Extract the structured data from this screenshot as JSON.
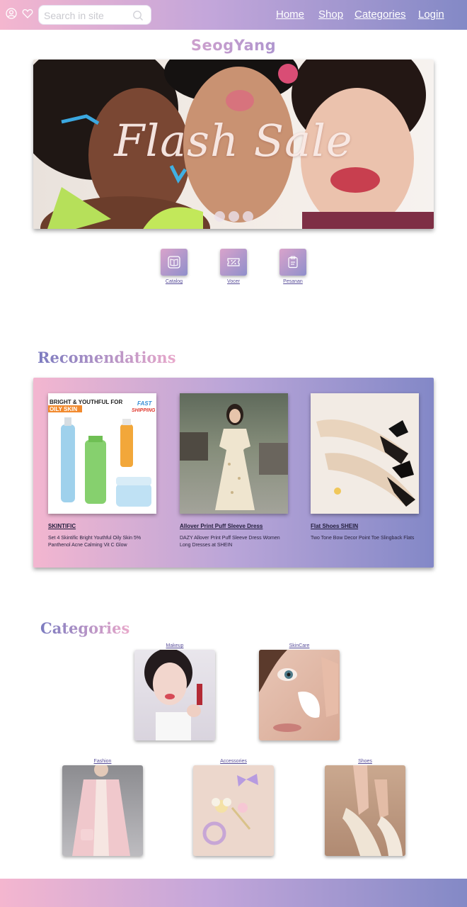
{
  "header": {
    "search_placeholder": "Search in site",
    "nav": [
      "Home",
      "Shop",
      "Categories",
      "Login"
    ]
  },
  "brand": "SeogYang",
  "hero": {
    "title": "Flash Sale",
    "slide_count": 3
  },
  "quick_links": [
    {
      "label": "Catalog",
      "icon": "book-icon"
    },
    {
      "label": "Vocer",
      "icon": "percent-ticket-icon"
    },
    {
      "label": "Pesanan",
      "icon": "clipboard-icon"
    }
  ],
  "recommendations": {
    "title": "Recomendations",
    "items": [
      {
        "name": "SKINTIFIC",
        "desc": "Set 4 Skintific Bright Youthful Oily Skin 5% Panthenol Acne Calming Vit C Glow",
        "image_text": {
          "headline": "BRIGHT & YOUTHFUL FOR",
          "tag": "OILY SKIN",
          "badge_line1": "FAST",
          "badge_line2": "SHIPPING"
        }
      },
      {
        "name": "Allover Print Puff Sleeve Dress",
        "desc": "DAZY Allover Print Puff Sleeve Dress Women Long Dresses at SHEIN"
      },
      {
        "name": "Flat Shoes SHEIN",
        "desc": "Two Tone Bow Decor Point Toe Slingback Flats"
      }
    ]
  },
  "categories": {
    "title": "Categories",
    "items": [
      "Makeup",
      "SkinCare",
      "Fashion",
      "Accessories",
      "Shoes"
    ]
  },
  "colors": {
    "gradient_pink": "#f4b6cf",
    "gradient_lavender": "#c3a6da",
    "gradient_blue": "#8389c6",
    "link": "#5a4f9a"
  }
}
